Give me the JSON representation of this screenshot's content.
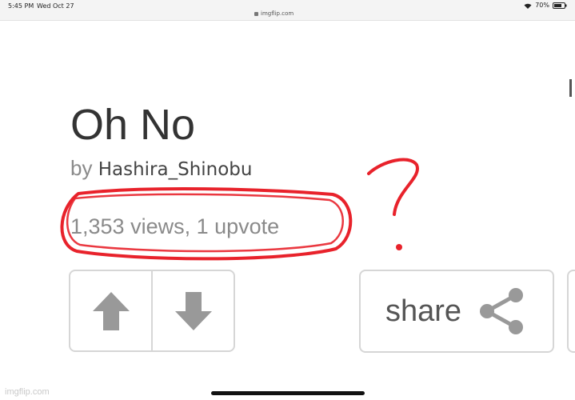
{
  "status_bar": {
    "time": "5:45 PM",
    "date": "Wed Oct 27",
    "url": "imgflip.com",
    "battery": "70%"
  },
  "post": {
    "title": "Oh No",
    "by_prefix": "by",
    "author": "Hashira_Shinobu",
    "stats": "1,353 views, 1 upvote"
  },
  "actions": {
    "upvote_icon": "arrow-up-icon",
    "downvote_icon": "arrow-down-icon",
    "share_label": "share",
    "share_icon": "share-icon"
  },
  "annotation": {
    "mark": "?",
    "color": "#e8222b"
  },
  "watermark": "imgflip.com",
  "colors": {
    "button_icon": "#999999",
    "button_border": "#d6d6d6",
    "muted_text": "#8a8a8a"
  }
}
